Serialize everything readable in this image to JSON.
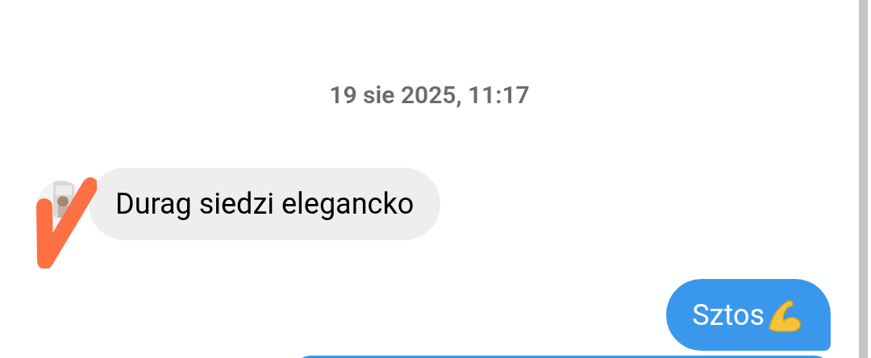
{
  "timestamp": "19 sie 2025, 11:17",
  "messages": [
    {
      "kind": "incoming",
      "text": "Durag siedzi elegancko"
    },
    {
      "kind": "outgoing",
      "text": "Sztos",
      "emoji_icon": true
    },
    {
      "kind": "outgoing-partial"
    }
  ]
}
